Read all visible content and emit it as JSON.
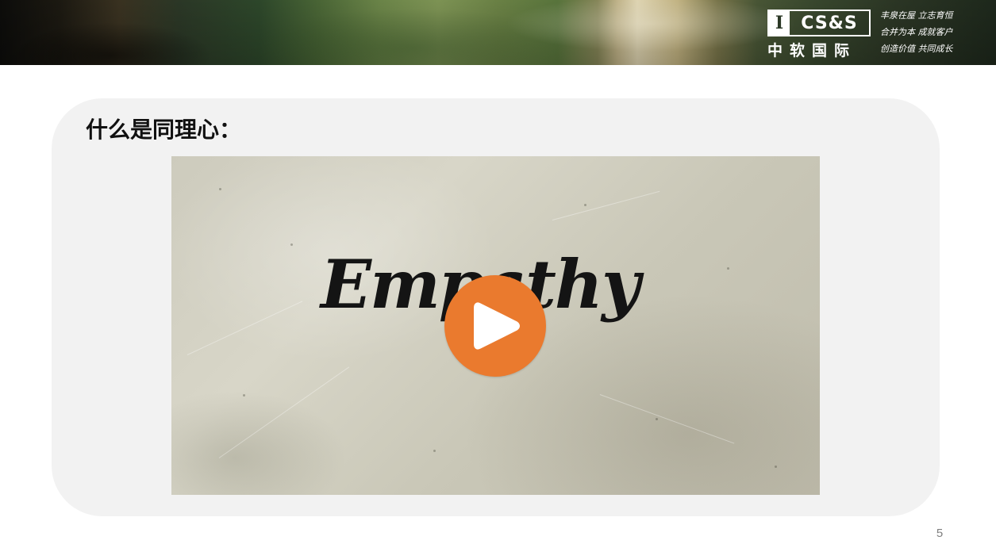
{
  "header": {
    "logo": {
      "mark": "I",
      "name_en": "CS&S",
      "name_cn": "中软国际"
    },
    "motto": [
      "丰泉在屋 立志育恒",
      "合并为本 成就客户",
      "创造价值 共同成长"
    ]
  },
  "slide": {
    "title": "什么是同理心：",
    "video": {
      "title_text": "Empathy"
    },
    "page_number": "5"
  },
  "colors": {
    "play_button": "#ea7a2e",
    "panel": "#f2f2f2",
    "title": "#111111"
  },
  "icons": {
    "play": "play-icon"
  }
}
